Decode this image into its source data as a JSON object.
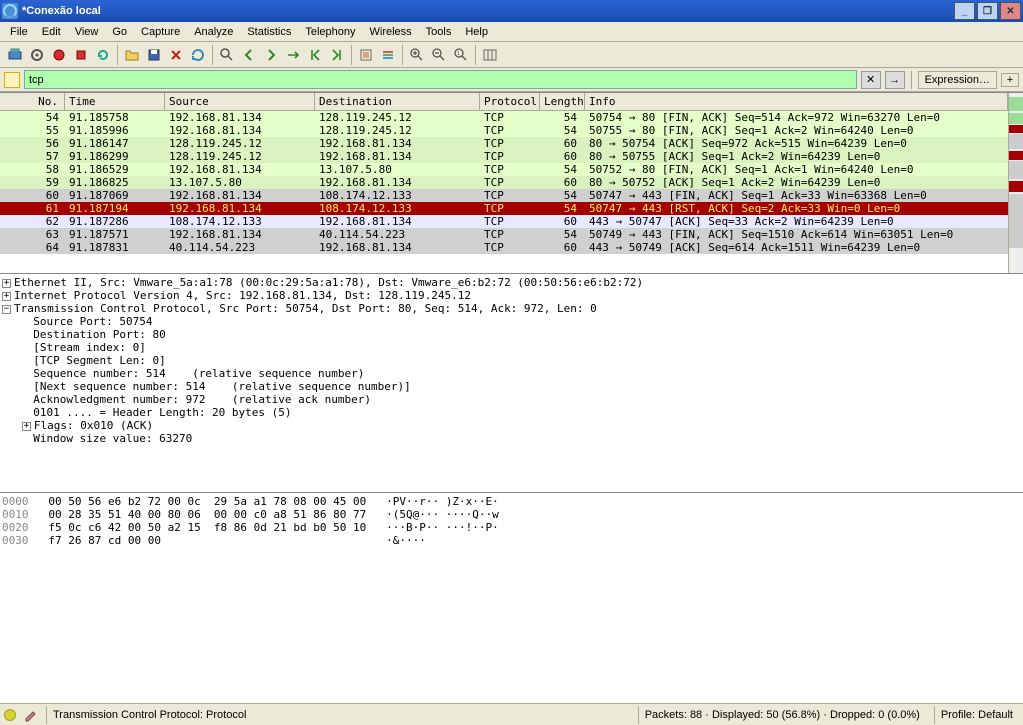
{
  "window": {
    "title": "*Conexão local"
  },
  "menu": [
    "File",
    "Edit",
    "View",
    "Go",
    "Capture",
    "Analyze",
    "Statistics",
    "Telephony",
    "Wireless",
    "Tools",
    "Help"
  ],
  "filter": {
    "value": "tcp",
    "expression_label": "Expression…",
    "plus": "+"
  },
  "columns": {
    "no": "No.",
    "time": "Time",
    "source": "Source",
    "destination": "Destination",
    "protocol": "Protocol",
    "length": "Length",
    "info": "Info"
  },
  "packets": [
    {
      "no": "54",
      "time": "91.185758",
      "src": "192.168.81.134",
      "dst": "128.119.245.12",
      "proto": "TCP",
      "len": "54",
      "info": "50754 → 80 [FIN, ACK] Seq=514 Ack=972 Win=63270 Len=0",
      "cls": "green"
    },
    {
      "no": "55",
      "time": "91.185996",
      "src": "192.168.81.134",
      "dst": "128.119.245.12",
      "proto": "TCP",
      "len": "54",
      "info": "50755 → 80 [FIN, ACK] Seq=1 Ack=2 Win=64240 Len=0",
      "cls": "green"
    },
    {
      "no": "56",
      "time": "91.186147",
      "src": "128.119.245.12",
      "dst": "192.168.81.134",
      "proto": "TCP",
      "len": "60",
      "info": "80 → 50754 [ACK] Seq=972 Ack=515 Win=64239 Len=0",
      "cls": "lgreen"
    },
    {
      "no": "57",
      "time": "91.186299",
      "src": "128.119.245.12",
      "dst": "192.168.81.134",
      "proto": "TCP",
      "len": "60",
      "info": "80 → 50755 [ACK] Seq=1 Ack=2 Win=64239 Len=0",
      "cls": "lgreen"
    },
    {
      "no": "58",
      "time": "91.186529",
      "src": "192.168.81.134",
      "dst": "13.107.5.80",
      "proto": "TCP",
      "len": "54",
      "info": "50752 → 80 [FIN, ACK] Seq=1 Ack=1 Win=64240 Len=0",
      "cls": "green"
    },
    {
      "no": "59",
      "time": "91.186825",
      "src": "13.107.5.80",
      "dst": "192.168.81.134",
      "proto": "TCP",
      "len": "60",
      "info": "80 → 50752 [ACK] Seq=1 Ack=2 Win=64239 Len=0",
      "cls": "lgreen"
    },
    {
      "no": "60",
      "time": "91.187069",
      "src": "192.168.81.134",
      "dst": "108.174.12.133",
      "proto": "TCP",
      "len": "54",
      "info": "50747 → 443 [FIN, ACK] Seq=1 Ack=33 Win=63368 Len=0",
      "cls": "gray"
    },
    {
      "no": "61",
      "time": "91.187194",
      "src": "192.168.81.134",
      "dst": "108.174.12.133",
      "proto": "TCP",
      "len": "54",
      "info": "50747 → 443 [RST, ACK] Seq=2 Ack=33 Win=0 Len=0",
      "cls": "red"
    },
    {
      "no": "62",
      "time": "91.187286",
      "src": "108.174.12.133",
      "dst": "192.168.81.134",
      "proto": "TCP",
      "len": "60",
      "info": "443 → 50747 [ACK] Seq=33 Ack=2 Win=64239 Len=0",
      "cls": "lightblue"
    },
    {
      "no": "63",
      "time": "91.187571",
      "src": "192.168.81.134",
      "dst": "40.114.54.223",
      "proto": "TCP",
      "len": "54",
      "info": "50749 → 443 [FIN, ACK] Seq=1510 Ack=614 Win=63051 Len=0",
      "cls": "gray"
    },
    {
      "no": "64",
      "time": "91.187831",
      "src": "40.114.54.223",
      "dst": "192.168.81.134",
      "proto": "TCP",
      "len": "60",
      "info": "443 → 50749 [ACK] Seq=614 Ack=1511 Win=64239 Len=0",
      "cls": "gray"
    }
  ],
  "details": {
    "eth": "Ethernet II, Src: Vmware_5a:a1:78 (00:0c:29:5a:a1:78), Dst: Vmware_e6:b2:72 (00:50:56:e6:b2:72)",
    "ip": "Internet Protocol Version 4, Src: 192.168.81.134, Dst: 128.119.245.12",
    "tcp": "Transmission Control Protocol, Src Port: 50754, Dst Port: 80, Seq: 514, Ack: 972, Len: 0",
    "lines": [
      "Source Port: 50754",
      "Destination Port: 80",
      "[Stream index: 0]",
      "[TCP Segment Len: 0]",
      "Sequence number: 514    (relative sequence number)",
      "[Next sequence number: 514    (relative sequence number)]",
      "Acknowledgment number: 972    (relative ack number)",
      "0101 .... = Header Length: 20 bytes (5)"
    ],
    "flags": "Flags: 0x010 (ACK)",
    "window": "Window size value: 63270"
  },
  "hex": [
    {
      "off": "0000",
      "b": "00 50 56 e6 b2 72 00 0c  29 5a a1 78 08 00 45 00",
      "a": "·PV··r·· )Z·x··E·"
    },
    {
      "off": "0010",
      "b": "00 28 35 51 40 00 80 06  00 00 c0 a8 51 86 80 77",
      "a": "·(5Q@··· ····Q··w"
    },
    {
      "off": "0020",
      "b": "f5 0c c6 42 00 50 a2 15  f8 86 0d 21 bd b0 50 10",
      "a": "···B·P·· ···!··P·"
    },
    {
      "off": "0030",
      "b": "f7 26 87 cd 00 00",
      "a": "·&····"
    }
  ],
  "status": {
    "left": "Transmission Control Protocol: Protocol",
    "packets": "Packets: 88 · Displayed: 50 (56.8%) · Dropped: 0 (0.0%)",
    "profile": "Profile: Default"
  }
}
